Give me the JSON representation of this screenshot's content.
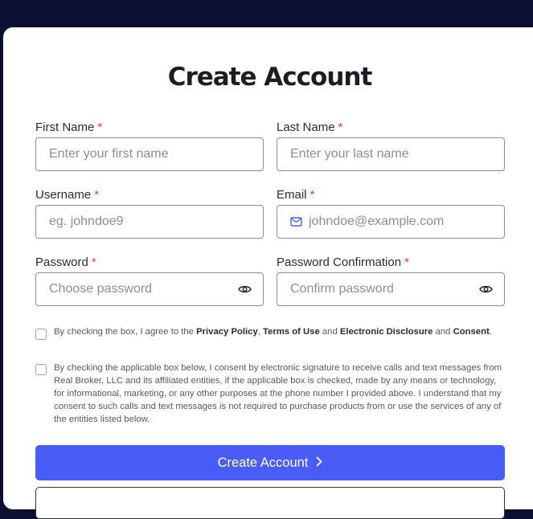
{
  "form": {
    "title": "Create Account",
    "first_name": {
      "label": "First Name",
      "placeholder": "Enter your first name"
    },
    "last_name": {
      "label": "Last Name",
      "placeholder": "Enter your last name"
    },
    "username": {
      "label": "Username",
      "placeholder": "eg. johndoe9"
    },
    "email": {
      "label": "Email",
      "placeholder": "johndoe@example.com",
      "icon": "mail-icon"
    },
    "password": {
      "label": "Password",
      "placeholder": "Choose password",
      "icon": "eye-icon"
    },
    "password_confirm": {
      "label": "Password Confirmation",
      "placeholder": "Confirm password",
      "icon": "eye-icon"
    },
    "required_mark": "*",
    "consent1": {
      "prefix": "By checking the box, I agree to the",
      "privacy": "Privacy Policy",
      "comma": ",",
      "terms": "Terms of Use",
      "and1": "and",
      "electronic": "Electronic Disclosure",
      "and2": "and",
      "consent": "Consent",
      "period": "."
    },
    "consent2": "By checking the applicable box below, I consent by electronic signature to receive calls and text messages from Real Broker, LLC and its affiliated entities, if the applicable box is checked, made by any means or technology, for informational, marketing, or any other purposes at the phone number I provided above. I understand that my consent to such calls and text messages is not required to purchase products from or use the services of any of the entities listed below.",
    "submit_label": "Create Account",
    "submit_icon": "chevron-right-icon"
  },
  "colors": {
    "background": "#0b1033",
    "primary": "#4a5cf6",
    "required": "#e0394f"
  }
}
